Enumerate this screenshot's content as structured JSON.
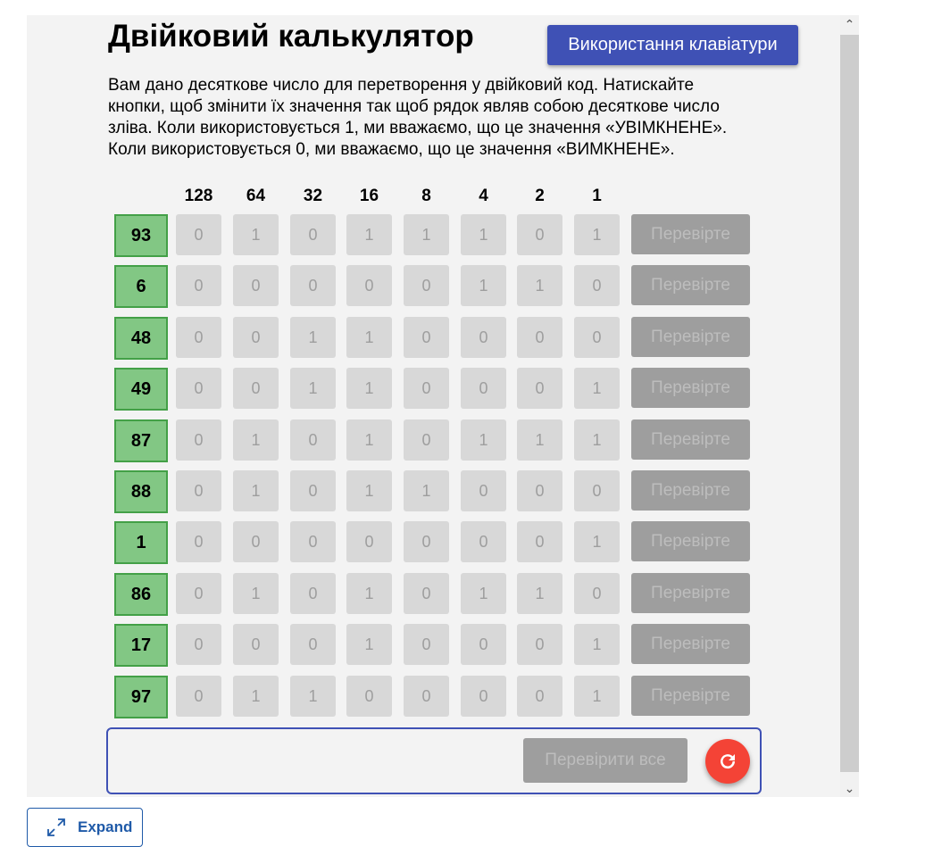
{
  "app": {
    "title": "Двійковий калькулятор",
    "keyboard_button": "Використання клавіатури",
    "description": "Вам дано десяткове число для перетворення у двійковий код. Натискайте кнопки, щоб змінити їх значення так щоб рядок являв собою десяткове число зліва. Коли використовується 1, ми вважаємо, що це значення «УВІМКНЕНЕ». Коли використовується 0, ми вважаємо, що це значення «ВИМКНЕНЕ»."
  },
  "headers": [
    "128",
    "64",
    "32",
    "16",
    "8",
    "4",
    "2",
    "1"
  ],
  "rows": [
    {
      "decimal": "93",
      "bits": [
        "0",
        "1",
        "0",
        "1",
        "1",
        "1",
        "0",
        "1"
      ],
      "check": "Перевірте"
    },
    {
      "decimal": "6",
      "bits": [
        "0",
        "0",
        "0",
        "0",
        "0",
        "1",
        "1",
        "0"
      ],
      "check": "Перевірте"
    },
    {
      "decimal": "48",
      "bits": [
        "0",
        "0",
        "1",
        "1",
        "0",
        "0",
        "0",
        "0"
      ],
      "check": "Перевірте"
    },
    {
      "decimal": "49",
      "bits": [
        "0",
        "0",
        "1",
        "1",
        "0",
        "0",
        "0",
        "1"
      ],
      "check": "Перевірте"
    },
    {
      "decimal": "87",
      "bits": [
        "0",
        "1",
        "0",
        "1",
        "0",
        "1",
        "1",
        "1"
      ],
      "check": "Перевірте"
    },
    {
      "decimal": "88",
      "bits": [
        "0",
        "1",
        "0",
        "1",
        "1",
        "0",
        "0",
        "0"
      ],
      "check": "Перевірте"
    },
    {
      "decimal": "1",
      "bits": [
        "0",
        "0",
        "0",
        "0",
        "0",
        "0",
        "0",
        "1"
      ],
      "check": "Перевірте"
    },
    {
      "decimal": "86",
      "bits": [
        "0",
        "1",
        "0",
        "1",
        "0",
        "1",
        "1",
        "0"
      ],
      "check": "Перевірте"
    },
    {
      "decimal": "17",
      "bits": [
        "0",
        "0",
        "0",
        "1",
        "0",
        "0",
        "0",
        "1"
      ],
      "check": "Перевірте"
    },
    {
      "decimal": "97",
      "bits": [
        "0",
        "1",
        "1",
        "0",
        "0",
        "0",
        "0",
        "1"
      ],
      "check": "Перевірте"
    }
  ],
  "footer": {
    "check_all": "Перевірити все",
    "reset_icon": "refresh-icon"
  },
  "expand": {
    "label": "Expand",
    "icon": "expand-arrows-icon"
  },
  "colors": {
    "accent": "#3f51b5",
    "decimal_fill": "#82c784",
    "decimal_border": "#43a047",
    "reset": "#f44336",
    "disabled_button": "#9e9e9e",
    "bit_fill": "#d8d8d8"
  }
}
